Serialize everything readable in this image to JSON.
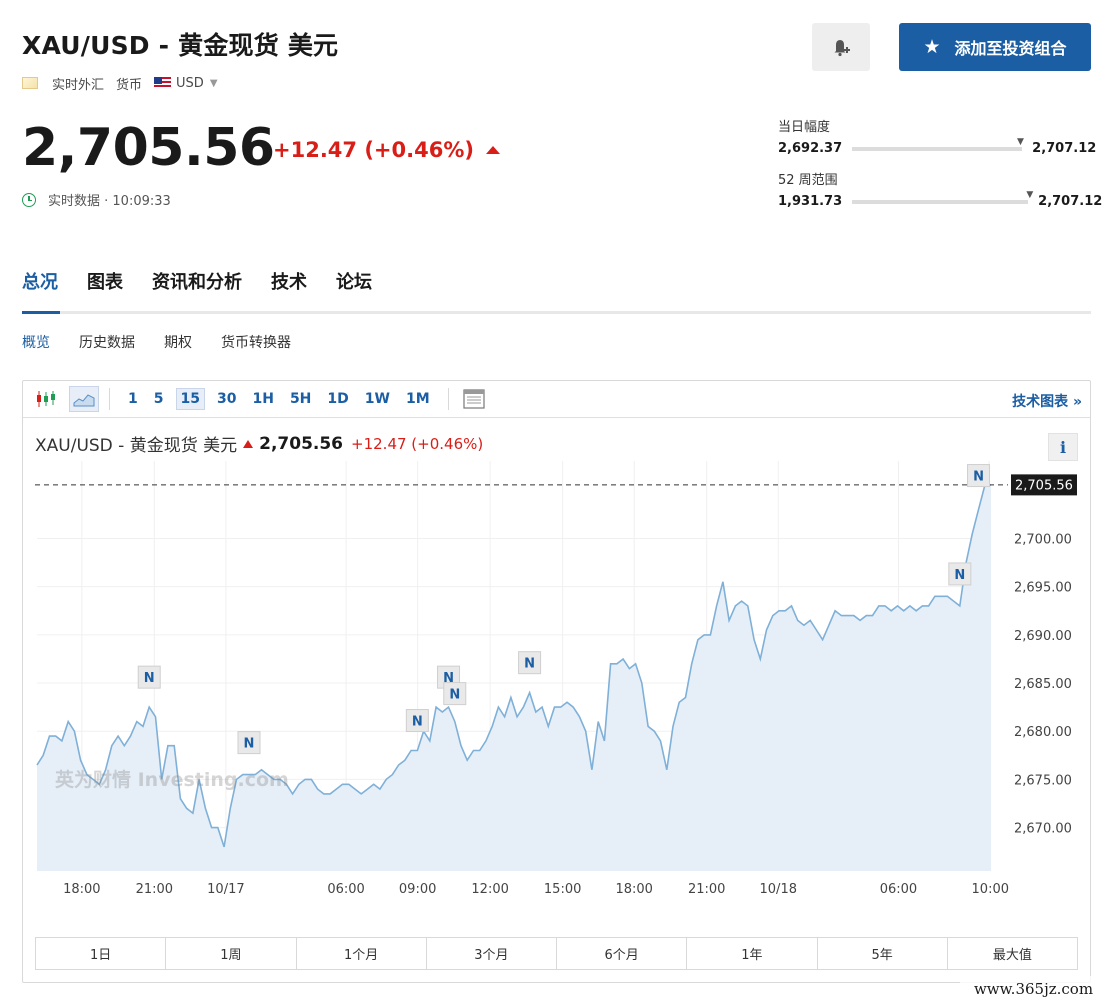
{
  "header": {
    "title": "XAU/USD - 黄金现货 美元",
    "market_label": "实时外汇",
    "currency_label": "货币",
    "currency_value": "USD",
    "add_button_label": "添加至投资组合"
  },
  "quote": {
    "price": "2,705.56",
    "change": "+12.47 (+0.46%)",
    "realtime_text": "实时数据 · 10:09:33"
  },
  "ranges": {
    "day_label": "当日幅度",
    "day_low": "2,692.37",
    "day_high": "2,707.12",
    "day_position": 0.97,
    "week52_label": "52 周范围",
    "week52_low": "1,931.73",
    "week52_high": "2,707.12",
    "week52_position": 0.99
  },
  "tabs": [
    "总况",
    "图表",
    "资讯和分析",
    "技术",
    "论坛"
  ],
  "subnav": [
    "概览",
    "历史数据",
    "期权",
    "货币转换器"
  ],
  "toolbar": {
    "intervals": [
      "1",
      "5",
      "15",
      "30",
      "1H",
      "5H",
      "1D",
      "1W",
      "1M"
    ],
    "active_interval": "15",
    "tech_link": "技术图表 »"
  },
  "chart_legend": {
    "symbol": "XAU/USD - 黄金现货 美元",
    "price": "2,705.56",
    "change": "+12.47 (+0.46%)"
  },
  "periods": [
    "1日",
    "1周",
    "1个月",
    "3个月",
    "6个月",
    "1年",
    "5年",
    "最大值"
  ],
  "watermark": "www.365jz.com",
  "logo_text": "英为财情 Investing.com",
  "colors": {
    "accent": "#1b5ea3",
    "up": "#d91e18",
    "line": "#7fb0d8",
    "fill": "#e6eff8"
  },
  "chart_data": {
    "type": "area",
    "title": "XAU/USD - 黄金现货 美元",
    "x_tick_labels": [
      "18:00",
      "21:00",
      "10/17",
      "06:00",
      "09:00",
      "12:00",
      "15:00",
      "18:00",
      "21:00",
      "10/18",
      "06:00",
      "10:00"
    ],
    "y_tick_labels": [
      "2,700.00",
      "2,695.00",
      "2,690.00",
      "2,685.00",
      "2,680.00",
      "2,675.00",
      "2,670.00"
    ],
    "ylim": [
      2665.5,
      2707.0
    ],
    "last_price_label": "2,705.56",
    "last_price": 2705.56,
    "news_markers": [
      "N",
      "N",
      "N",
      "N",
      "N",
      "N",
      "N",
      "N"
    ],
    "values": [
      2676.5,
      2677.5,
      2679.5,
      2679.5,
      2679.0,
      2681.0,
      2680.0,
      2677.0,
      2675.5,
      2675.0,
      2674.5,
      2676.0,
      2678.5,
      2679.5,
      2678.5,
      2679.5,
      2681.0,
      2680.5,
      2682.5,
      2681.5,
      2675.0,
      2678.5,
      2678.5,
      2673.0,
      2672.0,
      2671.5,
      2675.0,
      2672.0,
      2670.0,
      2670.0,
      2668.0,
      2672.0,
      2675.0,
      2675.5,
      2675.5,
      2675.5,
      2676.0,
      2675.5,
      2675.0,
      2675.0,
      2674.5,
      2673.5,
      2674.5,
      2675.0,
      2675.0,
      2674.0,
      2673.5,
      2673.5,
      2674.0,
      2674.5,
      2674.5,
      2674.0,
      2673.5,
      2674.0,
      2674.5,
      2674.0,
      2675.0,
      2675.5,
      2676.5,
      2677.0,
      2678.0,
      2678.0,
      2680.0,
      2679.0,
      2682.5,
      2682.0,
      2682.5,
      2681.0,
      2678.5,
      2677.0,
      2678.0,
      2678.0,
      2679.0,
      2680.5,
      2682.5,
      2681.5,
      2683.5,
      2681.5,
      2682.5,
      2684.0,
      2682.0,
      2682.5,
      2680.5,
      2682.5,
      2682.5,
      2683.0,
      2682.5,
      2681.5,
      2680.0,
      2676.0,
      2681.0,
      2679.0,
      2687.0,
      2687.0,
      2687.5,
      2686.5,
      2687.0,
      2685.0,
      2680.5,
      2680.0,
      2679.0,
      2676.0,
      2680.5,
      2683.0,
      2683.5,
      2687.0,
      2689.5,
      2690.0,
      2690.0,
      2693.0,
      2695.5,
      2691.5,
      2693.0,
      2693.5,
      2693.0,
      2689.5,
      2687.5,
      2690.5,
      2692.0,
      2692.5,
      2692.5,
      2693.0,
      2691.5,
      2691.0,
      2691.5,
      2690.5,
      2689.5,
      2691.0,
      2692.5,
      2692.0,
      2692.0,
      2692.0,
      2691.5,
      2692.0,
      2692.0,
      2693.0,
      2693.0,
      2692.5,
      2693.0,
      2692.5,
      2693.0,
      2692.5,
      2693.0,
      2693.0,
      2694.0,
      2694.0,
      2694.0,
      2693.5,
      2693.0,
      2697.5,
      2700.5,
      2703.0,
      2705.5,
      2705.56
    ]
  }
}
